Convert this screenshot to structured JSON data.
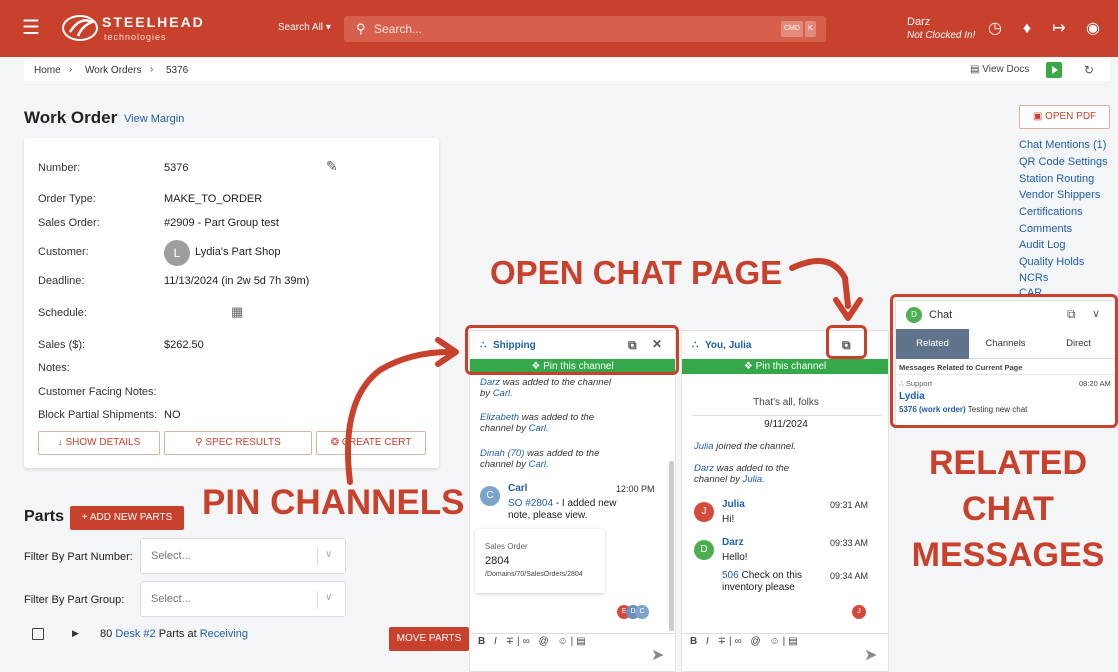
{
  "topbar": {
    "brand": "STEELHEAD",
    "brand_sub": "technologies",
    "search_scope": "Search All",
    "search_placeholder": "Search...",
    "kbd1": "CMD",
    "kbd2": "K",
    "user_name": "Darz",
    "clock_status": "Not Clocked In!"
  },
  "breadcrumb": {
    "home": "Home",
    "work_orders": "Work Orders",
    "current": "5376",
    "view_docs": "View Docs"
  },
  "work_order": {
    "title": "Work Order",
    "view_margin": "View Margin",
    "fields": {
      "number_label": "Number:",
      "number": "5376",
      "order_type_label": "Order Type:",
      "order_type": "MAKE_TO_ORDER",
      "sales_order_label": "Sales Order:",
      "sales_order": "#2909 - Part Group test",
      "customer_label": "Customer:",
      "customer_initial": "L",
      "customer": "Lydia's Part Shop",
      "deadline_label": "Deadline:",
      "deadline": "11/13/2024 (in 2w 5d 7h 39m)",
      "schedule_label": "Schedule:",
      "sales_label": "Sales ($):",
      "sales": "$262.50",
      "notes_label": "Notes:",
      "customer_notes_label": "Customer Facing Notes:",
      "block_partial_label": "Block Partial Shipments:",
      "block_partial": "NO"
    },
    "buttons": {
      "show_details": "SHOW DETAILS",
      "spec_results": "SPEC RESULTS",
      "create_cert": "CREATE CERT"
    }
  },
  "parts": {
    "title": "Parts",
    "add_button": "+ ADD NEW PARTS",
    "filter_number_label": "Filter By Part Number:",
    "filter_group_label": "Filter By Part Group:",
    "select_placeholder": "Select...",
    "row": {
      "count": "80",
      "desk": "Desk #2",
      "parts_at": "Parts at",
      "location": "Receiving"
    },
    "move_button": "MOVE PARTS"
  },
  "right_links": {
    "open_pdf": "OPEN PDF",
    "items": [
      "Chat Mentions (1)",
      "QR Code Settings",
      "Station Routing",
      "Vendor Shippers",
      "Certifications",
      "Comments",
      "Audit Log",
      "Quality Holds",
      "NCRs"
    ]
  },
  "shipping_chat": {
    "title": "Shipping",
    "pin": "Pin this channel",
    "sys1_user": "Darz",
    "sys1_text": "was added to the channel by",
    "sys1_by": "Carl.",
    "sys2_user": "Elizabeth",
    "sys2_text": "was added to the channel by",
    "sys2_by": "Carl.",
    "sys3_user": "Dinah (70)",
    "sys3_text": "was added to the channel by",
    "sys3_by": "Carl.",
    "msg_initial": "C",
    "msg_sender": "Carl",
    "msg_time": "12:00 PM",
    "msg_link": "SO #2804",
    "msg_text": "- I added new note, please view.",
    "card_label": "Sales Order",
    "card_number": "2804",
    "card_path": "/Domains/70/SalesOrders/2804",
    "readers": [
      "E",
      "D",
      "C"
    ]
  },
  "julia_chat": {
    "title": "You, Julia",
    "pin": "Pin this channel",
    "folks": "That's all, folks",
    "date": "9/11/2024",
    "sys1_user": "Julia",
    "sys1_text": "joined the channel.",
    "sys2_user": "Darz",
    "sys2_text": "was added to the channel by",
    "sys2_by": "Julia.",
    "m1_initial": "J",
    "m1_sender": "Julia",
    "m1_time": "09:31 AM",
    "m1_text": "Hi!",
    "m2_initial": "D",
    "m2_sender": "Darz",
    "m2_time": "09:33 AM",
    "m2_text": "Hello!",
    "m3_link": "506",
    "m3_text": "Check on this inventory please",
    "m3_time": "09:34 AM",
    "reader": "J"
  },
  "chat_panel": {
    "avatar": "D",
    "title": "Chat",
    "tabs": [
      "Related",
      "Channels",
      "Direct"
    ],
    "section": "Messages Related to Current Page",
    "channel": "Support",
    "time": "08:20 AM",
    "sender": "Lydia",
    "link": "5376 (work order)",
    "text": "Testing new chat",
    "cut_off": "CAR"
  },
  "annotations": {
    "open_chat": "OPEN CHAT PAGE",
    "pin_channels": "PIN CHANNELS",
    "related_1": "RELATED",
    "related_2": "CHAT",
    "related_3": "MESSAGES"
  },
  "colors": {
    "brand": "#c8412c",
    "pin_green": "#35a84a",
    "link_blue": "#1f5fa8"
  }
}
